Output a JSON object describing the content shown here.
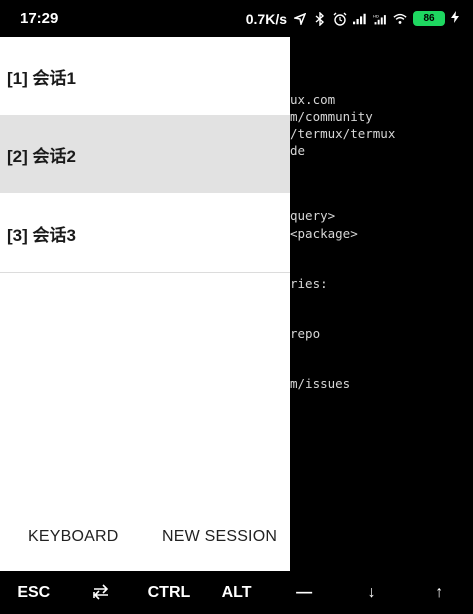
{
  "status_bar": {
    "time": "17:29",
    "net_speed": "0.7K/s",
    "battery_level": "86",
    "icons": [
      "location-arrow-icon",
      "bluetooth-icon",
      "alarm-icon",
      "signal-icon",
      "hd-signal-icon",
      "wifi-icon",
      "battery-icon",
      "charging-icon"
    ],
    "colors": {
      "battery": "#1ed760"
    }
  },
  "terminal": {
    "lines": [
      "ux.com",
      "m/community",
      "/termux/termux",
      "de",
      "query>",
      "<package>",
      "ries:",
      "repo",
      "m/issues"
    ]
  },
  "drawer": {
    "sessions": [
      {
        "label": "[1] 会话1",
        "active": false
      },
      {
        "label": "[2] 会话2",
        "active": true
      },
      {
        "label": "[3] 会话3",
        "active": false
      }
    ],
    "keyboard_button": "KEYBOARD",
    "new_session_button": "NEW SESSION"
  },
  "extra_keys": {
    "esc": "ESC",
    "tab_icon": "tab-arrows-icon",
    "ctrl": "CTRL",
    "alt": "ALT",
    "minus": "—",
    "down": "↓",
    "up": "↑"
  }
}
